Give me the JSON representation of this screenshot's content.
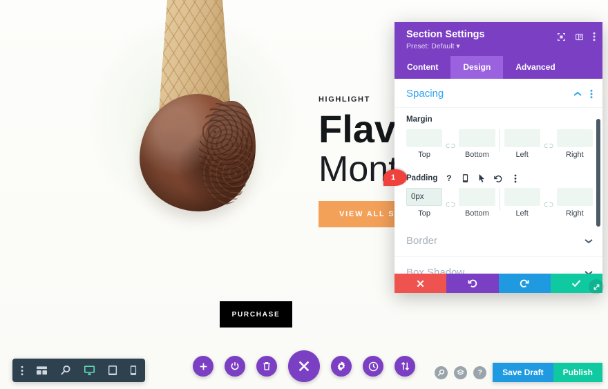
{
  "page_content": {
    "kicker": "HIGHLIGHT",
    "heading_bold": "Flavor of the",
    "heading_light": "Month",
    "cta_label": "VIEW ALL SEASONAL FLAVORS",
    "purchase_label": "PURCHASE",
    "image_name": "chocolate-ice-cream-cone"
  },
  "callout": {
    "number": "1"
  },
  "modal": {
    "title": "Section Settings",
    "preset": "Preset: Default",
    "preset_caret": "▾",
    "header_icons": [
      {
        "name": "focus-target-icon"
      },
      {
        "name": "layout-panel-icon"
      },
      {
        "name": "more-vertical-icon"
      }
    ],
    "tabs": [
      {
        "label": "Content",
        "active": false
      },
      {
        "label": "Design",
        "active": true
      },
      {
        "label": "Advanced",
        "active": false
      }
    ],
    "sections": [
      {
        "title": "Spacing",
        "state": "expanded",
        "collapse_icon": "chevron-up-icon",
        "menu_icon": "more-vertical-icon",
        "fields": [
          {
            "label": "Margin",
            "tools": [],
            "inputs": [
              {
                "side": "Top",
                "value": "",
                "placeholder": ""
              },
              {
                "side": "Bottom",
                "value": "",
                "placeholder": ""
              },
              {
                "side": "Left",
                "value": "",
                "placeholder": ""
              },
              {
                "side": "Right",
                "value": "",
                "placeholder": ""
              }
            ],
            "link_icon": "link-toggle-icon"
          },
          {
            "label": "Padding",
            "tools": [
              {
                "name": "help-icon",
                "glyph": "?"
              },
              {
                "name": "responsive-phone-icon",
                "glyph": ""
              },
              {
                "name": "hover-cursor-icon",
                "glyph": ""
              },
              {
                "name": "reset-icon",
                "glyph": ""
              },
              {
                "name": "more-vertical-icon",
                "glyph": ""
              }
            ],
            "inputs": [
              {
                "side": "Top",
                "value": "0px",
                "placeholder": "",
                "focused": true
              },
              {
                "side": "Bottom",
                "value": "",
                "placeholder": ""
              },
              {
                "side": "Left",
                "value": "",
                "placeholder": ""
              },
              {
                "side": "Right",
                "value": "",
                "placeholder": ""
              }
            ],
            "link_icon": "link-toggle-icon"
          }
        ]
      },
      {
        "title": "Border",
        "state": "collapsed",
        "collapse_icon": "chevron-down-icon"
      },
      {
        "title": "Box Shadow",
        "state": "collapsed",
        "collapse_icon": "chevron-down-icon"
      }
    ],
    "footer": [
      {
        "name": "cancel-button",
        "icon": "close-x-icon",
        "color": "#ef5350"
      },
      {
        "name": "undo-button",
        "icon": "undo-icon",
        "color": "#7b3fc4"
      },
      {
        "name": "redo-button",
        "icon": "redo-icon",
        "color": "#1f9ae0"
      },
      {
        "name": "save-button",
        "icon": "check-icon",
        "color": "#0fc9a0"
      }
    ],
    "resize_handle": "resize-grip-icon"
  },
  "device_bar": {
    "items": [
      {
        "name": "more-vertical-icon",
        "active": false
      },
      {
        "name": "wireframe-icon",
        "active": false
      },
      {
        "name": "zoom-icon",
        "active": false
      },
      {
        "name": "desktop-icon",
        "active": true
      },
      {
        "name": "tablet-icon",
        "active": false
      },
      {
        "name": "phone-icon",
        "active": false
      }
    ]
  },
  "main_bar": {
    "items": [
      {
        "name": "add-module-button",
        "icon": "plus-icon",
        "size": "small"
      },
      {
        "name": "toggle-builder-button",
        "icon": "power-icon",
        "size": "small"
      },
      {
        "name": "trash-button",
        "icon": "trash-icon",
        "size": "small"
      },
      {
        "name": "close-builder-button",
        "icon": "close-x-icon",
        "size": "large"
      },
      {
        "name": "settings-button",
        "icon": "gear-icon",
        "size": "small"
      },
      {
        "name": "history-button",
        "icon": "clock-icon",
        "size": "small"
      },
      {
        "name": "portability-button",
        "icon": "updown-arrows-icon",
        "size": "small"
      }
    ]
  },
  "right_bar": {
    "icons": [
      {
        "name": "search-icon",
        "glyph": "⌕"
      },
      {
        "name": "layers-icon",
        "glyph": "◉"
      },
      {
        "name": "help-icon",
        "glyph": "?"
      }
    ],
    "save_draft_label": "Save Draft",
    "publish_label": "Publish"
  },
  "colors": {
    "brand_purple": "#7b3fc4",
    "tab_active_purple": "#9a62de",
    "accent_blue": "#2ea3f2",
    "publish_teal": "#0fc9a0",
    "draft_blue": "#1f9ae0",
    "cancel_red": "#ef5350",
    "callout_red": "#f0423d",
    "cta_orange": "#f3a059",
    "devbar_dark": "#2e414f",
    "input_mint": "#eef6f2"
  }
}
